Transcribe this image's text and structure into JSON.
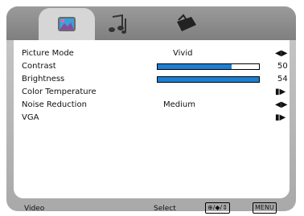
{
  "tabs": [
    {
      "name": "picture",
      "active": true
    },
    {
      "name": "audio",
      "active": false
    },
    {
      "name": "setup",
      "active": false
    }
  ],
  "menu": {
    "rows": [
      {
        "label": "Picture Mode",
        "value": "Vivid",
        "icon": "arrows"
      },
      {
        "label": "Contrast",
        "level": 50,
        "value": "50"
      },
      {
        "label": "Brightness",
        "level": 54,
        "value": "54"
      },
      {
        "label": "Color Temperature",
        "icon": "submenu"
      },
      {
        "label": "Noise Reduction",
        "value": "Medium",
        "icon": "arrows"
      },
      {
        "label": "VGA",
        "icon": "submenu"
      }
    ]
  },
  "footer": {
    "source": "Video",
    "select": "Select",
    "select_badge": "⊕/◆/⇕",
    "menu_badge": "MENU"
  },
  "colors": {
    "accent": "#1e7fd2"
  }
}
